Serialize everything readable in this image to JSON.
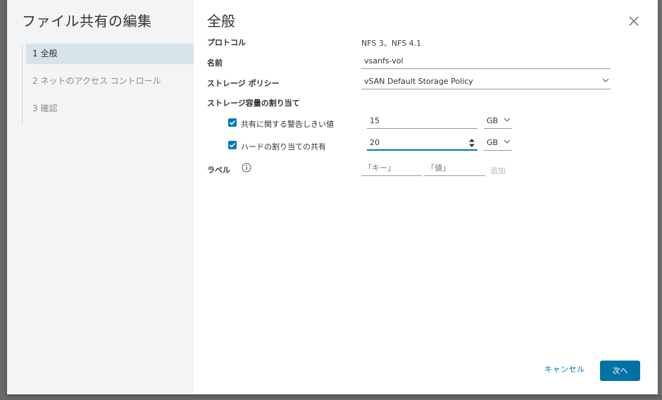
{
  "dialog": {
    "title": "ファイル共有の編集",
    "steps": [
      {
        "label": "1 全般"
      },
      {
        "label": "2 ネットのアクセス コントロール"
      },
      {
        "label": "3 確認"
      }
    ],
    "section_title": "全般",
    "close_icon": "close-icon"
  },
  "form": {
    "protocol_label": "プロトコル",
    "protocol_value": "NFS 3、NFS 4.1",
    "name_label": "名前",
    "name_value": "vsanfs-vol",
    "policy_label": "ストレージ ポリシー",
    "policy_value": "vSAN Default Storage Policy",
    "quota_label": "ストレージ容量の割り当て",
    "warning": {
      "label": "共有に関する警告しきい値",
      "checked": true,
      "value": "15",
      "unit": "GB"
    },
    "hard": {
      "label": "ハードの割り当ての共有",
      "checked": true,
      "value": "20",
      "unit": "GB"
    },
    "labels_label": "ラベル",
    "key_placeholder": "「キー」",
    "value_placeholder": "「値」",
    "add_label": "追加"
  },
  "footer": {
    "cancel_label": "キャンセル",
    "next_label": "次へ"
  },
  "colors": {
    "accent": "#0079b8",
    "primary_button": "#0072a3"
  }
}
